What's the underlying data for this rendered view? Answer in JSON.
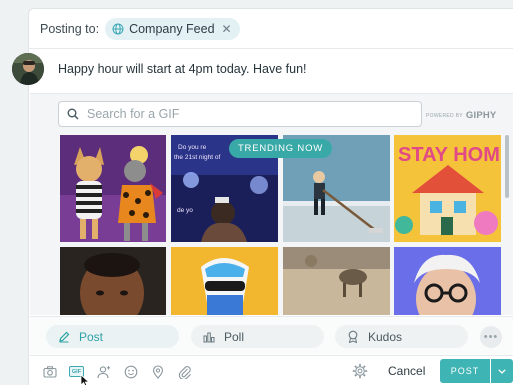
{
  "posting_to": {
    "label": "Posting to:",
    "audience": "Company Feed",
    "close_glyph": "✕"
  },
  "author": {
    "avatar_icon": "user-avatar"
  },
  "message": {
    "text": "Happy hour will start at 4pm today. Have fun!"
  },
  "gif_picker": {
    "search_placeholder": "Search for a GIF",
    "powered_by": "POWERED BY",
    "provider": "GIPHY",
    "trending_label": "TRENDING NOW",
    "gif_captions": {
      "gif_2_top": "Do you re",
      "gif_2_mid": "the 21st night of",
      "gif_2_bottom": "de yo"
    }
  },
  "post_types": [
    {
      "label": "Post",
      "icon": "pencil-icon",
      "active": true
    },
    {
      "label": "Poll",
      "icon": "bar-chart-icon",
      "active": false
    },
    {
      "label": "Kudos",
      "icon": "ribbon-icon",
      "active": false
    }
  ],
  "toolbar": {
    "icons": [
      "camera-icon",
      "gif-icon",
      "mention-user-icon",
      "emoji-icon",
      "location-icon",
      "attachment-icon",
      "settings-icon"
    ],
    "gif_icon_text": "GIF",
    "cancel_label": "Cancel",
    "post_label": "POST"
  },
  "colors": {
    "accent": "#3fb4b5",
    "trending_badge": "#39a9a8",
    "chip_bg": "#e3f1f5"
  }
}
